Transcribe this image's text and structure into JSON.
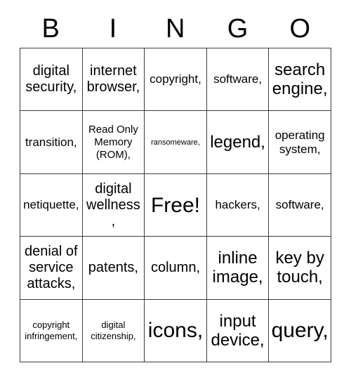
{
  "card": {
    "header_letters": [
      "B",
      "I",
      "N",
      "G",
      "O"
    ],
    "columns": 5,
    "rows": 5,
    "border_color": "#3b3b3b",
    "text_color": "#000000",
    "background_color": "#ffffff",
    "free_space": "Free!",
    "cells": [
      [
        {
          "text": "digital security,",
          "size": "l"
        },
        {
          "text": "internet browser,",
          "size": "l"
        },
        {
          "text": "copyright,",
          "size": "m"
        },
        {
          "text": "software,",
          "size": "m"
        },
        {
          "text": "search engine,",
          "size": "xl"
        }
      ],
      [
        {
          "text": "transition,",
          "size": "m"
        },
        {
          "text": "Read Only Memory (ROM),",
          "size": "s"
        },
        {
          "text": "ransomeware,",
          "size": "xxs"
        },
        {
          "text": "legend,",
          "size": "xl"
        },
        {
          "text": "operating system,",
          "size": "m"
        }
      ],
      [
        {
          "text": "netiquette,",
          "size": "m"
        },
        {
          "text": "digital wellness,",
          "size": "l"
        },
        {
          "text": "Free!",
          "size": "xxl"
        },
        {
          "text": "hackers,",
          "size": "m"
        },
        {
          "text": "software,",
          "size": "m"
        }
      ],
      [
        {
          "text": "denial of service attacks,",
          "size": "l"
        },
        {
          "text": "patents,",
          "size": "l"
        },
        {
          "text": "column,",
          "size": "l"
        },
        {
          "text": "inline image,",
          "size": "xl"
        },
        {
          "text": "key by touch,",
          "size": "xl"
        }
      ],
      [
        {
          "text": "copyright infringement,",
          "size": "xs"
        },
        {
          "text": "digital citizenship,",
          "size": "xs"
        },
        {
          "text": "icons,",
          "size": "xxl"
        },
        {
          "text": "input device,",
          "size": "xl"
        },
        {
          "text": "query,",
          "size": "xxl"
        }
      ]
    ]
  }
}
